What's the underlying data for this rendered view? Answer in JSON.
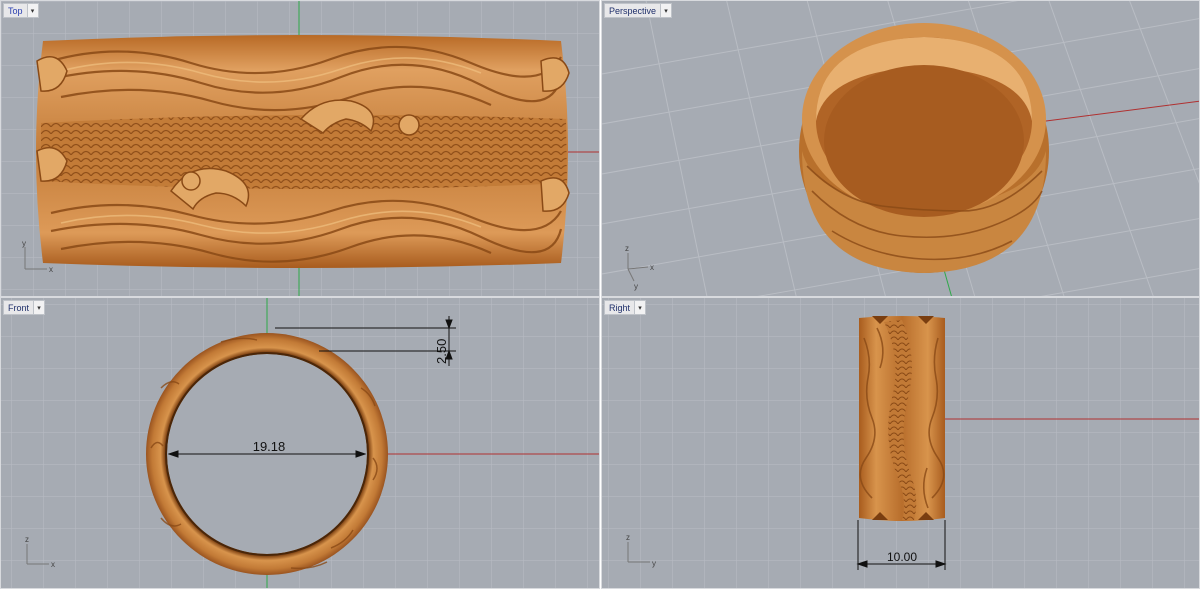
{
  "colors": {
    "viewport_bg": "#a6abb3",
    "grid": "#b8bcc3",
    "metal": "#c8823c",
    "x_axis": "#b03030",
    "y_axis": "#2fa84a",
    "z_axis": "#2a3fc8"
  },
  "viewports": {
    "top": {
      "label": "Top",
      "axis_x": "x",
      "axis_y": "y"
    },
    "perspective": {
      "label": "Perspective",
      "axis_x": "x",
      "axis_y": "y",
      "axis_z": "z"
    },
    "front": {
      "label": "Front",
      "axis_x": "x",
      "axis_z": "z",
      "dim_inner": "19.18",
      "dim_thickness": "2.50"
    },
    "right": {
      "label": "Right",
      "axis_y": "y",
      "axis_z": "z",
      "dim_width": "10.00"
    }
  }
}
